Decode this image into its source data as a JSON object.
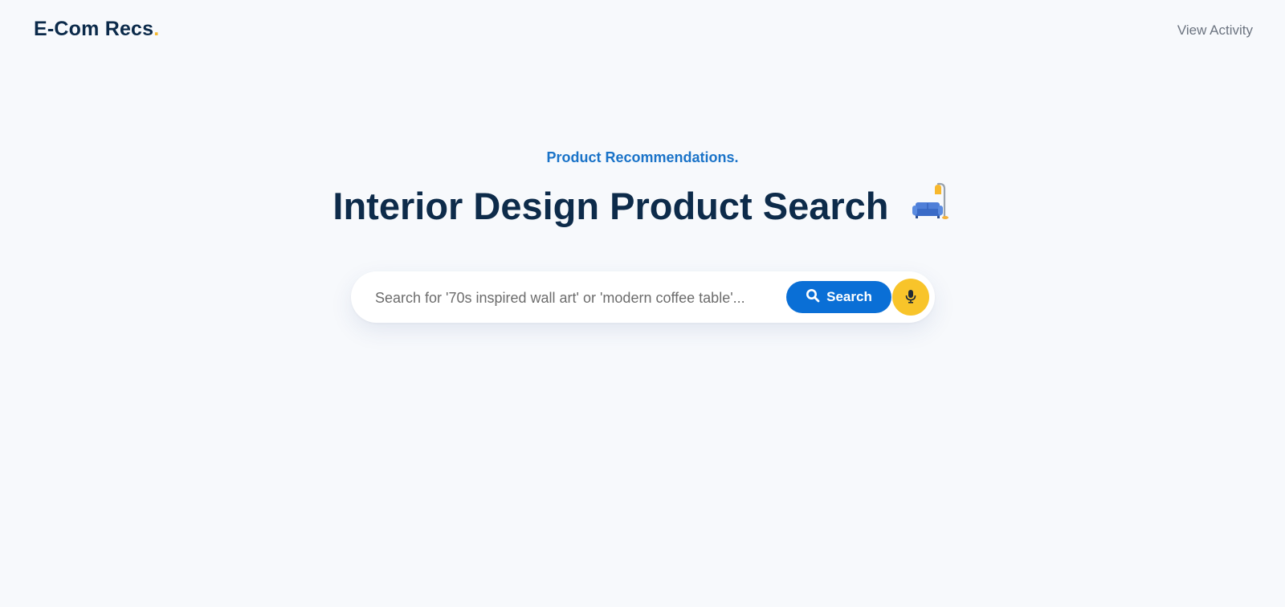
{
  "header": {
    "brand_name": "E-Com Recs",
    "brand_dot": ".",
    "nav_link": "View Activity"
  },
  "hero": {
    "eyebrow": "Product Recommendations.",
    "title": "Interior Design Product Search",
    "title_icon": "sofa-and-lamp-icon"
  },
  "search": {
    "placeholder": "Search for '70s inspired wall art' or 'modern coffee table'...",
    "value": "",
    "button_label": "Search",
    "button_icon": "search-icon",
    "mic_icon": "microphone-icon"
  },
  "colors": {
    "background": "#f7f9fc",
    "brand_text": "#0b2a4a",
    "accent_blue": "#0a6fd6",
    "eyebrow_blue": "#1a73c8",
    "accent_yellow": "#f8c42a"
  }
}
